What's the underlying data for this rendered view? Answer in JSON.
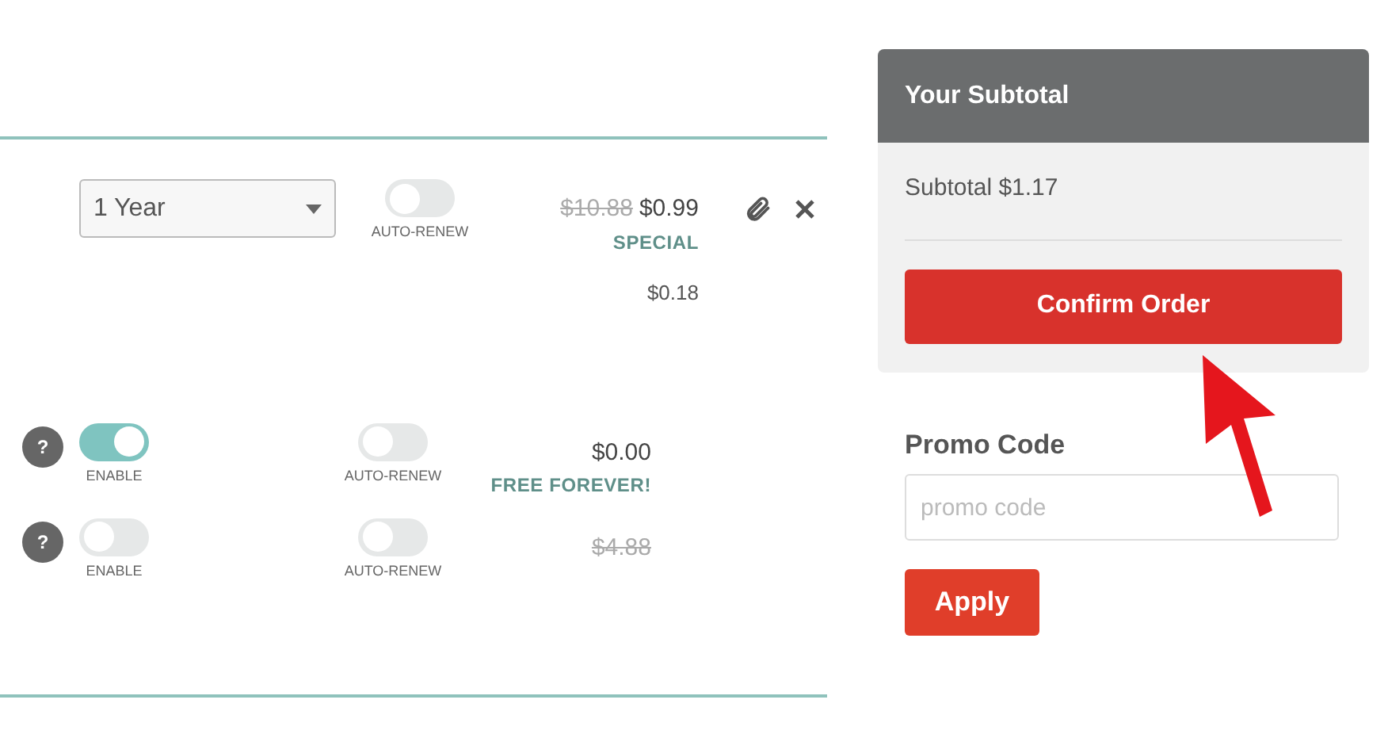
{
  "domain_row": {
    "term": {
      "value": "1 Year"
    },
    "auto_renew": {
      "label": "AUTO-RENEW",
      "on": false
    },
    "old_price": "$10.88",
    "price": "$0.99",
    "tag": "SPECIAL",
    "fee": "$0.18"
  },
  "addons": [
    {
      "help": "?",
      "enabled": true,
      "enable_label": "ENABLE",
      "auto_renew": {
        "label": "AUTO-RENEW",
        "on": false
      },
      "price": "$0.00",
      "struck": false,
      "tag": "FREE FOREVER!"
    },
    {
      "help": "?",
      "enabled": false,
      "enable_label": "ENABLE",
      "auto_renew": {
        "label": "AUTO-RENEW",
        "on": false
      },
      "price": "$4.88",
      "struck": true
    }
  ],
  "subtotal": {
    "title": "Your Subtotal",
    "line": "Subtotal $1.17",
    "button": "Confirm Order"
  },
  "promo": {
    "label": "Promo Code",
    "placeholder": "promo code",
    "button": "Apply"
  }
}
